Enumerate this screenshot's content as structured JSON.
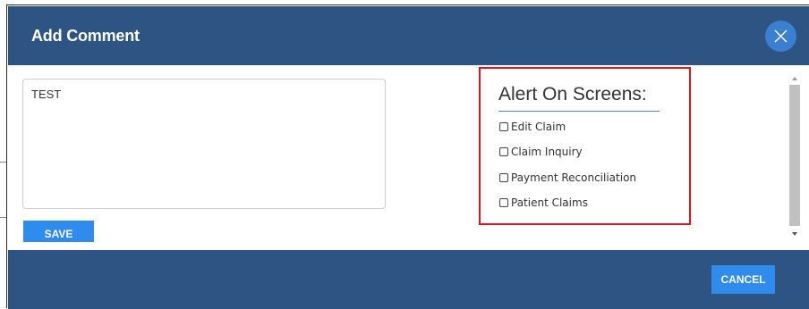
{
  "dialog": {
    "title": "Add Comment",
    "close_icon": "close-x-icon"
  },
  "comment": {
    "value": "TEST"
  },
  "save_label": "SAVE",
  "alert": {
    "title": "Alert On Screens:",
    "options": [
      {
        "label": "Edit Claim",
        "checked": false
      },
      {
        "label": "Claim Inquiry",
        "checked": false
      },
      {
        "label": "Payment Reconciliation",
        "checked": false
      },
      {
        "label": "Patient Claims",
        "checked": false
      }
    ]
  },
  "cancel_label": "CANCEL",
  "colors": {
    "header_bg": "#2d5482",
    "button_blue": "#2f8bec",
    "close_button": "#3b7fd0",
    "highlight_border": "#e0141a"
  }
}
